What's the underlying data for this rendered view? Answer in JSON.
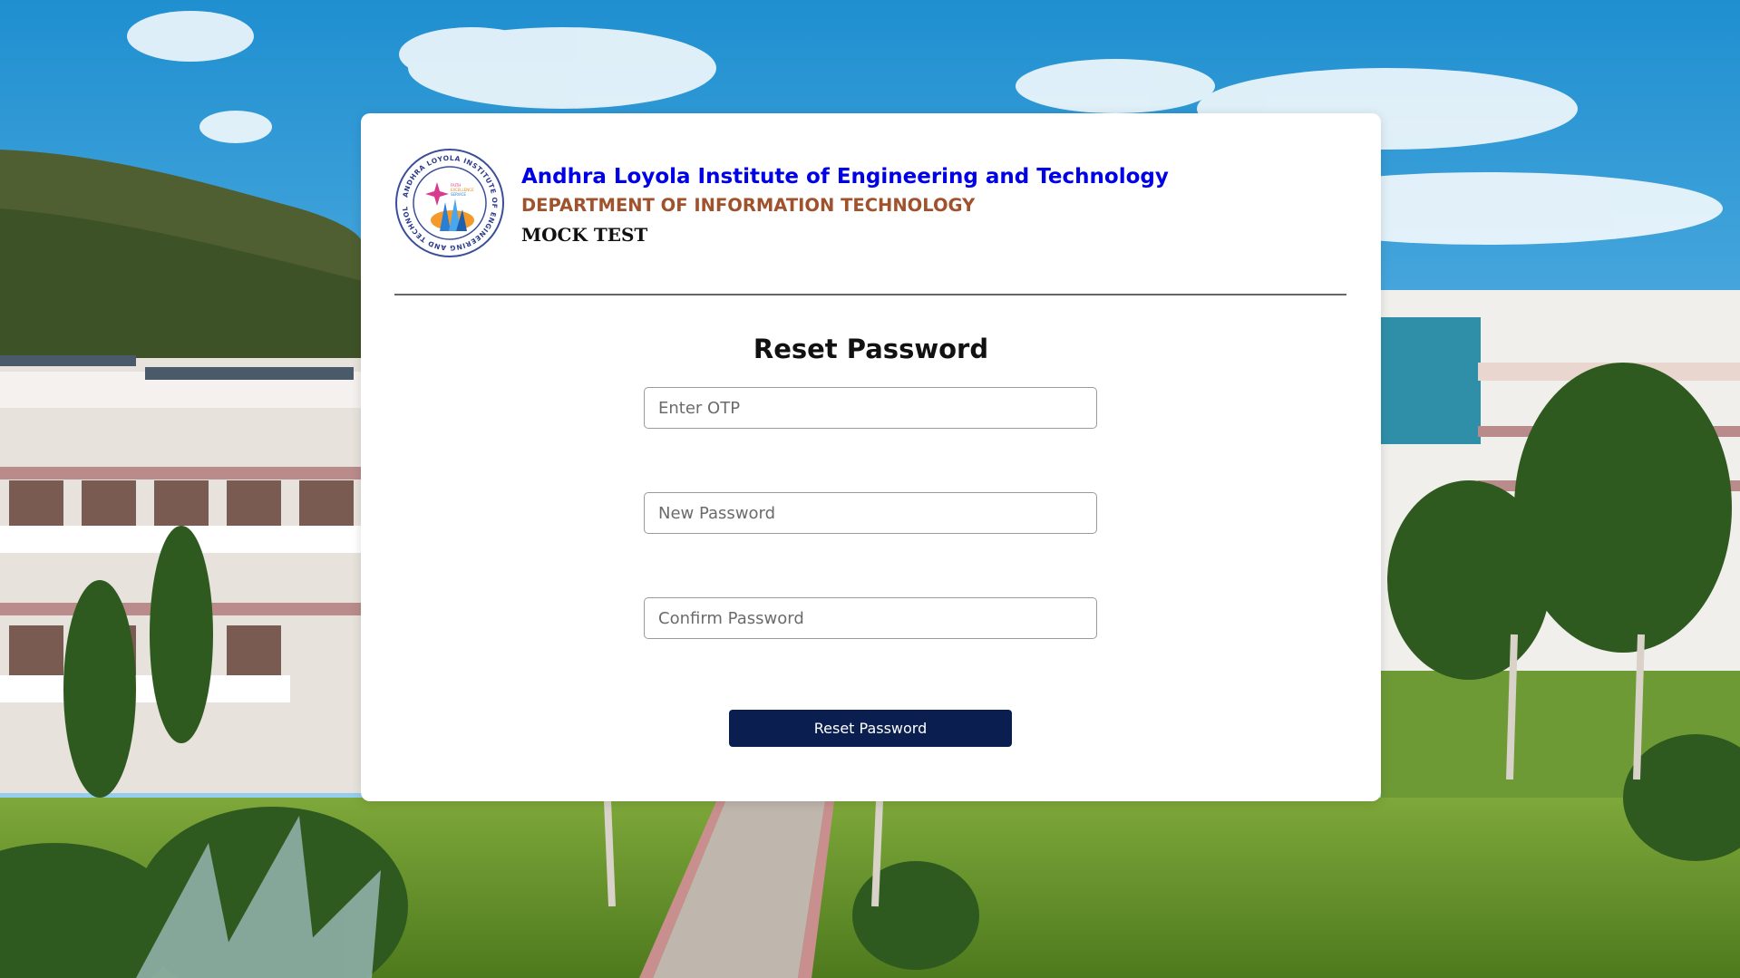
{
  "header": {
    "institute_name": "Andhra Loyola Institute of Engineering and Technology",
    "department": "DEPARTMENT OF INFORMATION TECHNOLOGY",
    "subtitle": "MOCK TEST",
    "logo": {
      "icon": "college-seal-icon",
      "ring_text": "ANDHRA LOYOLA INSTITUTE OF ENGINEERING AND TECHNOLOGY",
      "motto": [
        "FAITH",
        "EXCELLENCE",
        "SERVICE"
      ]
    }
  },
  "form": {
    "title": "Reset Password",
    "otp_placeholder": "Enter OTP",
    "new_password_placeholder": "New Password",
    "confirm_password_placeholder": "Confirm Password",
    "submit_label": "Reset Password"
  },
  "colors": {
    "institute_name": "#0000e6",
    "department": "#a0522d",
    "button": "#0a1f4f",
    "sky": "#3a9fd6",
    "grass": "#6f9a2e"
  }
}
